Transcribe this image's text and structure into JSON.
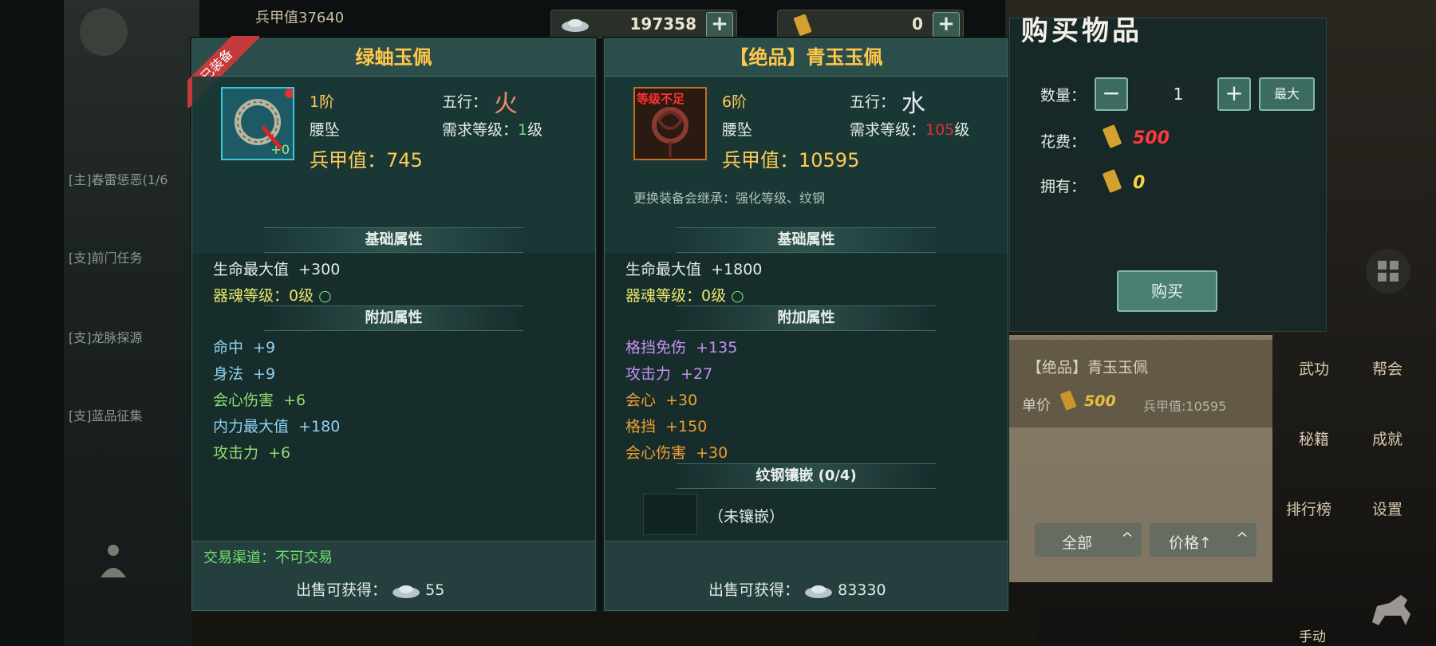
{
  "hud": {
    "silver_amount": "197358",
    "gold_amount": "0",
    "power_partial": "兵甲值37640"
  },
  "left_panel": {
    "title": "绿蚰玉佩",
    "equipped_badge": "已装备",
    "icon_plus": "+0",
    "tier": "1阶",
    "wuxing_label": "五行：",
    "wuxing_value": "火",
    "slot": "腰坠",
    "req_label": "需求等级：",
    "req_value": "1",
    "req_unit": "级",
    "power": "兵甲值：745",
    "base_section": "基础属性",
    "base": [
      {
        "name": "生命最大值",
        "value": "+300"
      },
      {
        "name": "器魂等级：0级",
        "value": "○"
      }
    ],
    "extra_section": "附加属性",
    "extra": [
      {
        "name": "命中",
        "value": "+9"
      },
      {
        "name": "身法",
        "value": "+9"
      },
      {
        "name": "会心伤害",
        "value": "+6"
      },
      {
        "name": "内力最大值",
        "value": "+180"
      },
      {
        "name": "攻击力",
        "value": "+6"
      }
    ],
    "trade_channel": "交易渠道：不可交易",
    "sell_label": "出售可获得：",
    "sell_value": "55"
  },
  "right_panel": {
    "title": "【绝品】青玉玉佩",
    "level_warning": "等级不足",
    "tier": "6阶",
    "wuxing_label": "五行：",
    "wuxing_value": "水",
    "slot": "腰坠",
    "req_label": "需求等级：",
    "req_value": "105",
    "req_unit": "级",
    "power": "兵甲值：10595",
    "inherit_note": "更换装备会继承：强化等级、纹钢",
    "base_section": "基础属性",
    "base": [
      {
        "name": "生命最大值",
        "value": "+1800"
      },
      {
        "name": "器魂等级：0级",
        "value": "○"
      }
    ],
    "extra_section": "附加属性",
    "extra": [
      {
        "name": "格挡免伤",
        "value": "+135"
      },
      {
        "name": "攻击力",
        "value": "+27"
      },
      {
        "name": "会心",
        "value": "+30"
      },
      {
        "name": "格挡",
        "value": "+150"
      },
      {
        "name": "会心伤害",
        "value": "+30"
      }
    ],
    "inlay_section": "纹钢镶嵌 (0/4)",
    "inlay_empty": "（未镶嵌）",
    "sell_label": "出售可获得：",
    "sell_value": "83330"
  },
  "buy_panel": {
    "title": "购买物品",
    "qty_label": "数量：",
    "qty_minus": "−",
    "qty_value": "1",
    "qty_plus": "+",
    "max_button": "最大",
    "cost_label": "花费：",
    "cost_value": "500",
    "own_label": "拥有：",
    "own_value": "0",
    "buy_button": "购买"
  },
  "shop_list": {
    "item_name": "【绝品】青玉玉佩",
    "unit_price_label": "单价",
    "unit_price": "500",
    "item_power": "兵甲值:10595",
    "filter_all": "全部",
    "sort_price": "价格↑"
  },
  "side_menu": {
    "wugong": "武功",
    "banghui": "帮会",
    "miji": "秘籍",
    "chengjiu": "成就",
    "paihangbang": "排行榜",
    "shezhi": "设置",
    "shoudong": "手动"
  },
  "background": {
    "quest_1": "[主]春雷惩恶(1/6",
    "quest_2": "[支]前门任务",
    "quest_3": "[支]龙脉探源",
    "quest_4": "[支]蓝品征集"
  },
  "colors": {
    "gold": "#ffcc55",
    "green_req": "#6fe06f",
    "red_req": "#e03030",
    "attr_blue": "#8fd1ef",
    "attr_green": "#8fdc6f",
    "attr_purple": "#c890f0",
    "attr_orange": "#f0a030",
    "yellow_text": "#e6e66a"
  }
}
